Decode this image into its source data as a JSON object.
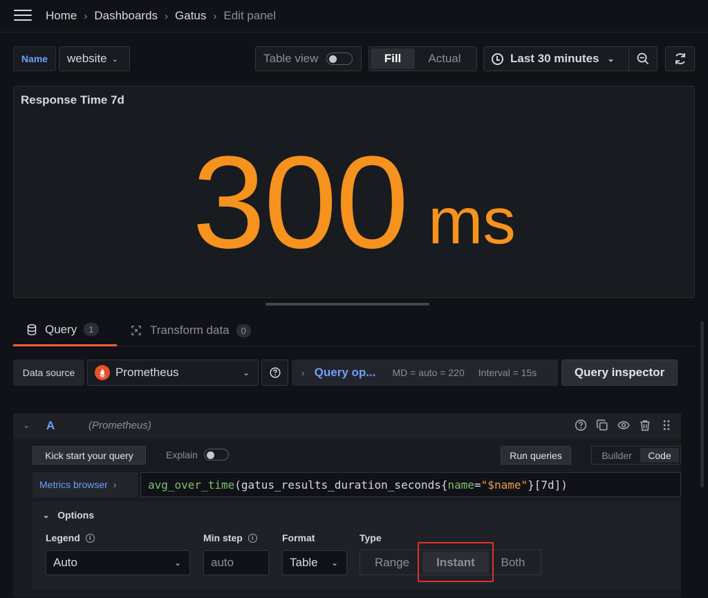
{
  "breadcrumb": {
    "items": [
      "Home",
      "Dashboards",
      "Gatus"
    ],
    "current": "Edit panel"
  },
  "toolbar": {
    "variable_label": "Name",
    "variable_value": "website",
    "table_view_label": "Table view",
    "fill_label": "Fill",
    "actual_label": "Actual",
    "time_range": "Last 30 minutes"
  },
  "panel": {
    "title": "Response Time 7d",
    "value": "300",
    "unit": "ms",
    "value_color": "#f6921e"
  },
  "tabs": {
    "query_label": "Query",
    "query_count": "1",
    "transform_label": "Transform data",
    "transform_count": "0"
  },
  "datasource": {
    "label": "Data source",
    "selected": "Prometheus",
    "query_options_label": "Query op...",
    "md_text": "MD = auto = 220",
    "interval_text": "Interval = 15s",
    "inspector_label": "Query inspector"
  },
  "query": {
    "ref_id": "A",
    "datasource_name": "(Prometheus)",
    "kickstart_label": "Kick start your query",
    "explain_label": "Explain",
    "run_label": "Run queries",
    "builder_label": "Builder",
    "code_label": "Code",
    "metrics_browser_label": "Metrics browser",
    "expr": {
      "fn": "avg_over_time",
      "open": "(",
      "metric": "gatus_results_duration_seconds",
      "brace_open": "{",
      "label_name": "name",
      "eq": "=",
      "label_value": "\"$name\"",
      "brace_close": "}",
      "range": "[7d]",
      "close": ")"
    }
  },
  "options": {
    "title": "Options",
    "legend_label": "Legend",
    "legend_value": "Auto",
    "minstep_label": "Min step",
    "minstep_placeholder": "auto",
    "format_label": "Format",
    "format_value": "Table",
    "type_label": "Type",
    "type_options": [
      "Range",
      "Instant",
      "Both"
    ],
    "type_selected": "Instant"
  },
  "accent_colors": {
    "link_blue": "#6e9fff",
    "active_tab": "#f55f3e",
    "highlight": "#e0332b"
  }
}
